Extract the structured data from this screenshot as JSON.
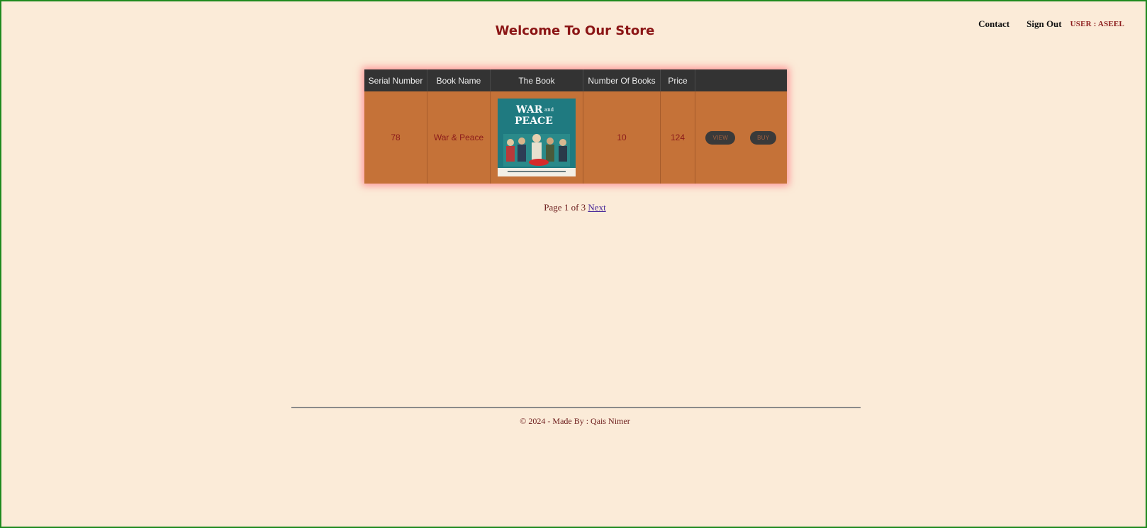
{
  "nav": {
    "contact": "Contact",
    "sign_out": "Sign Out",
    "user_label": "USER : ASEEL"
  },
  "page": {
    "title": "Welcome To Our Store"
  },
  "table": {
    "headers": [
      "Serial Number",
      "Book Name",
      "The Book",
      "Number Of Books",
      "Price",
      ""
    ],
    "rows": [
      {
        "serial": "78",
        "name": "War & Peace",
        "cover_title_line1": "WAR",
        "cover_title_small": "and",
        "cover_title_line2": "PEACE",
        "count": "10",
        "price": "124",
        "view_label": "VIEW",
        "buy_label": "BUY"
      }
    ]
  },
  "pagination": {
    "text": "Page 1 of 3",
    "next_label": "Next"
  },
  "footer": {
    "text": "© 2024 - Made By : Qais Nimer"
  },
  "colors": {
    "background": "#fbebd8",
    "header_bg": "#333333",
    "row_bg": "#c57238",
    "title": "#8b1515",
    "window_border": "#1e8a1e"
  },
  "icons": {
    "book_cover": "book-cover-image"
  }
}
